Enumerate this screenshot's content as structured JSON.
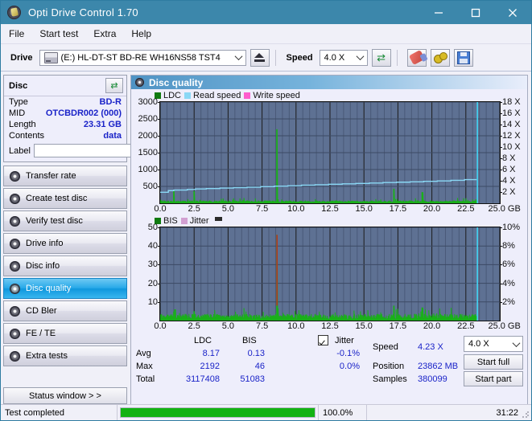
{
  "window": {
    "title": "Opti Drive Control 1.70",
    "icon": "disc-icon",
    "buttons": {
      "minimize": "minimize-icon",
      "maximize": "maximize-icon",
      "close": "close-icon"
    }
  },
  "menubar": {
    "items": [
      "File",
      "Start test",
      "Extra",
      "Help"
    ]
  },
  "toolbar": {
    "drive_label": "Drive",
    "drive_value": "(E:)  HL-DT-ST BD-RE  WH16NS58 TST4",
    "eject_icon": "eject-icon",
    "speed_label": "Speed",
    "speed_value": "4.0 X",
    "refresh_icon": "refresh-icon",
    "erase_icon": "eraser-icon",
    "settings_icon": "gears-icon",
    "save_icon": "floppy-icon"
  },
  "disc_panel": {
    "title": "Disc",
    "refresh_icon": "refresh-icon",
    "rows": [
      {
        "key": "Type",
        "value": "BD-R"
      },
      {
        "key": "MID",
        "value": "OTCBDR002 (000)"
      },
      {
        "key": "Length",
        "value": "23.31 GB"
      },
      {
        "key": "Contents",
        "value": "data"
      }
    ],
    "label_key": "Label",
    "label_value": "",
    "label_placeholder": "",
    "disc_icon": "disc-icon"
  },
  "sidebar": {
    "items": [
      {
        "label": "Transfer rate",
        "icon": "disc-icon",
        "selected": false
      },
      {
        "label": "Create test disc",
        "icon": "disc-icon",
        "selected": false
      },
      {
        "label": "Verify test disc",
        "icon": "disc-icon",
        "selected": false
      },
      {
        "label": "Drive info",
        "icon": "disc-icon",
        "selected": false
      },
      {
        "label": "Disc info",
        "icon": "disc-icon",
        "selected": false
      },
      {
        "label": "Disc quality",
        "icon": "disc-icon",
        "selected": true
      },
      {
        "label": "CD Bler",
        "icon": "disc-icon",
        "selected": false
      },
      {
        "label": "FE / TE",
        "icon": "disc-icon",
        "selected": false
      },
      {
        "label": "Extra tests",
        "icon": "disc-icon",
        "selected": false
      }
    ],
    "status_button": "Status window > >"
  },
  "main": {
    "header_title": "Disc quality",
    "header_icon": "disc-icon"
  },
  "stats": {
    "col_headers": [
      "LDC",
      "BIS"
    ],
    "jitter_label": "Jitter",
    "jitter_checked": true,
    "rows": [
      {
        "name": "Avg",
        "ldc": "8.17",
        "bis": "0.13",
        "jitter": "-0.1%"
      },
      {
        "name": "Max",
        "ldc": "2192",
        "bis": "46",
        "jitter": "0.0%"
      },
      {
        "name": "Total",
        "ldc": "3117408",
        "bis": "51083",
        "jitter": ""
      }
    ],
    "speed_label": "Speed",
    "speed_value": "4.23 X",
    "position_label": "Position",
    "position_value": "23862 MB",
    "samples_label": "Samples",
    "samples_value": "380099",
    "speed_select": "4.0 X",
    "start_full": "Start full",
    "start_part": "Start part"
  },
  "statusbar": {
    "message": "Test completed",
    "percent": "100.0%",
    "progress": 100,
    "elapsed": "31:22"
  },
  "colors": {
    "accent": "#3c87ab",
    "plot_bg": "#5e7193",
    "ldc_green": "#14a014",
    "read_speed": "#7fd9f5",
    "write_speed": "#ff55cc",
    "jitter": "#d2a0d2",
    "value_blue": "#1a23c8",
    "progress_green": "#12b212",
    "marker_red": "#d02020"
  },
  "chart_data": [
    {
      "type": "line",
      "title": "Disc quality - LDC / Read speed",
      "xlabel": "GB",
      "ylabel": "LDC",
      "y2label": "X",
      "xlim": [
        0,
        25
      ],
      "ylim": [
        0,
        3000
      ],
      "y2lim": [
        0,
        18
      ],
      "grid": true,
      "legend": [
        {
          "name": "LDC",
          "color": "#14a014"
        },
        {
          "name": "Read speed",
          "color": "#7fd9f5"
        },
        {
          "name": "Write speed",
          "color": "#ff55cc"
        }
      ],
      "xticks": [
        "0.0",
        "2.5",
        "5.0",
        "7.5",
        "10.0",
        "12.5",
        "15.0",
        "17.5",
        "20.0",
        "22.5",
        "25.0"
      ],
      "yticks": [
        500,
        1000,
        1500,
        2000,
        2500,
        3000
      ],
      "y2ticks": [
        "2 X",
        "4 X",
        "6 X",
        "8 X",
        "10 X",
        "12 X",
        "14 X",
        "16 X",
        "18 X"
      ],
      "series": [
        {
          "name": "Read speed",
          "color": "#7fd9f5",
          "axis": "right",
          "x": [
            0.0,
            0.6,
            1.0,
            2.0,
            2.6,
            3.4,
            4.4,
            5.4,
            6.4,
            7.4,
            8.4,
            9.4,
            10.4,
            11.4,
            12.4,
            13.4,
            14.4,
            15.4,
            16.4,
            17.4,
            18.4,
            19.4,
            20.4,
            21.4,
            22.4,
            23.3
          ],
          "y": [
            1.85,
            1.95,
            2.25,
            2.35,
            2.45,
            2.55,
            2.62,
            2.7,
            2.78,
            2.85,
            2.95,
            3.05,
            3.12,
            3.22,
            3.3,
            3.38,
            3.45,
            3.52,
            3.6,
            3.68,
            3.75,
            3.82,
            3.9,
            3.98,
            4.08,
            4.2
          ]
        },
        {
          "name": "LDC",
          "color": "#14a014",
          "axis": "left",
          "note": "dense spiky baseline near 0-150, one major spike 2192 at ~8.6 GB, smaller spikes ~400 at 1.0, ~350 at 2.5, ~430 at 17.2, ~300 at 19.3",
          "baseline": 70,
          "spikes": [
            {
              "x": 1.0,
              "y": 400
            },
            {
              "x": 2.5,
              "y": 360
            },
            {
              "x": 8.6,
              "y": 2192
            },
            {
              "x": 17.2,
              "y": 430
            },
            {
              "x": 19.3,
              "y": 330
            }
          ]
        }
      ],
      "markers": [
        {
          "name": "end-of-data",
          "x": 23.35,
          "color": "#40d8f8"
        }
      ]
    },
    {
      "type": "line",
      "title": "Disc quality - BIS / Jitter",
      "xlabel": "GB",
      "ylabel": "BIS",
      "y2label": "%",
      "xlim": [
        0,
        25
      ],
      "ylim": [
        0,
        50
      ],
      "y2lim": [
        0,
        10
      ],
      "grid": true,
      "legend": [
        {
          "name": "BIS",
          "color": "#14a014"
        },
        {
          "name": "Jitter",
          "color": "#d2a0d2"
        }
      ],
      "xticks": [
        "0.0",
        "2.5",
        "5.0",
        "7.5",
        "10.0",
        "12.5",
        "15.0",
        "17.5",
        "20.0",
        "22.5",
        "25.0"
      ],
      "yticks": [
        10,
        20,
        30,
        40,
        50
      ],
      "y2ticks": [
        "2%",
        "4%",
        "6%",
        "8%",
        "10%"
      ],
      "series": [
        {
          "name": "BIS",
          "color": "#14a014",
          "axis": "left",
          "note": "dense spiky baseline 2-5, peak 46 at ~8.6 GB (drawn red), minor peaks ~8 at 17.2 and ~7 at 19.3",
          "baseline": 3,
          "spikes": [
            {
              "x": 1.1,
              "y": 6
            },
            {
              "x": 2.5,
              "y": 5
            },
            {
              "x": 8.6,
              "y": 46
            },
            {
              "x": 17.2,
              "y": 8
            },
            {
              "x": 19.3,
              "y": 7
            }
          ]
        }
      ],
      "markers": [
        {
          "name": "peak-marker",
          "x": 8.6,
          "color": "#d02020"
        },
        {
          "name": "end-of-data",
          "x": 23.35,
          "color": "#40d8f8"
        }
      ]
    }
  ]
}
